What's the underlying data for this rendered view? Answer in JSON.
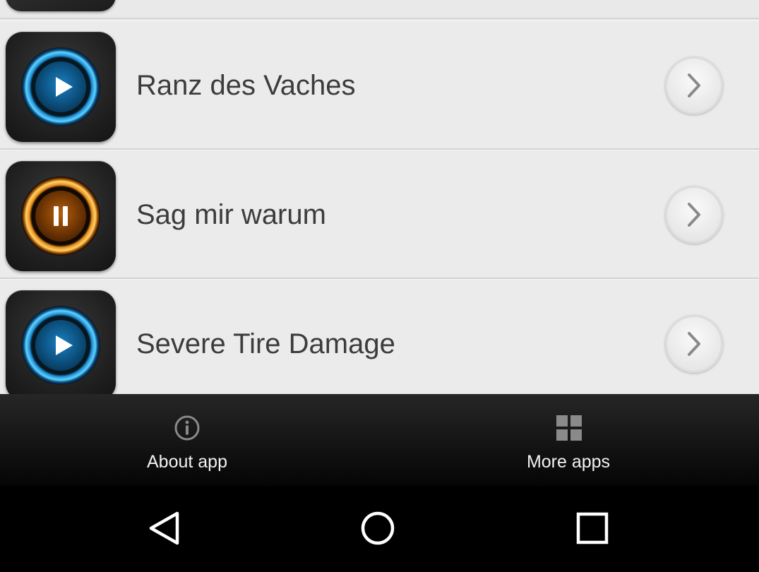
{
  "tracks": [
    {
      "title": "Ranz des Vaches",
      "state": "play",
      "ring_color": "blue",
      "icon": "play-icon"
    },
    {
      "title": "Sag mir warum",
      "state": "pause",
      "ring_color": "orange",
      "icon": "pause-icon"
    },
    {
      "title": "Severe Tire Damage",
      "state": "play",
      "ring_color": "blue",
      "icon": "play-icon"
    }
  ],
  "tabbar": {
    "about": {
      "label": "About app",
      "icon": "info-icon"
    },
    "more": {
      "label": "More apps",
      "icon": "grid-icon"
    }
  },
  "navbar": {
    "back_icon": "back-triangle-icon",
    "home_icon": "home-circle-icon",
    "recent_icon": "recents-square-icon"
  },
  "colors": {
    "list_bg": "#e9e9e9",
    "play_ring": "#5fd3ff",
    "pause_ring": "#ffd36a",
    "tabbar_bg": "#1a1a1a"
  }
}
